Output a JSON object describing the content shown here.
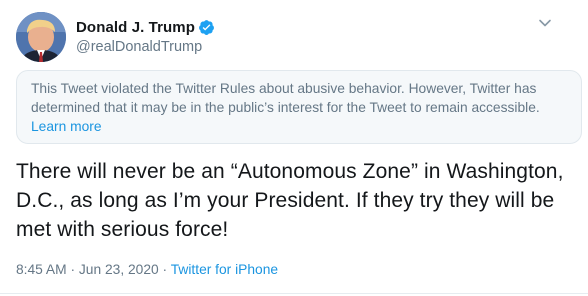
{
  "author": {
    "display_name": "Donald J. Trump",
    "handle": "@realDonaldTrump",
    "avatar_icon": "profile-photo",
    "verified_icon": "verified-badge-icon"
  },
  "notice": {
    "text": "This Tweet violated the Twitter Rules about abusive behavior. However, Twitter has determined that it may be in the public’s interest for the Tweet to remain accessible.",
    "link_label": "Learn more"
  },
  "tweet": {
    "text": "There will never be an “Autonomous Zone” in Washington, D.C., as long as I’m your President. If they try they will be met with serious force!"
  },
  "meta": {
    "time": "8:45 AM",
    "sep1": " · ",
    "date": "Jun 23, 2020",
    "sep2": " · ",
    "source": "Twitter for iPhone"
  },
  "colors": {
    "accent": "#1b95e0",
    "muted": "#657786",
    "text": "#14171a",
    "notice_bg": "#f5f8fa"
  }
}
